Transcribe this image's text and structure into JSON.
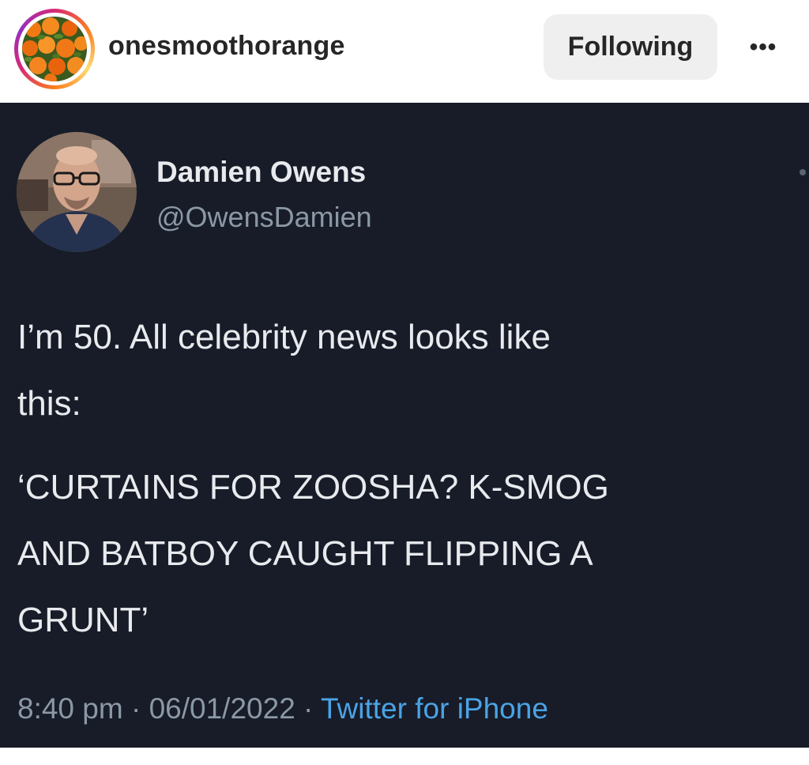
{
  "instagram": {
    "username": "onesmoothorange",
    "follow_label": "Following",
    "more_label": "•••"
  },
  "tweet": {
    "display_name": "Damien Owens",
    "handle": "@OwensDamien",
    "body_lines": [
      "I’m 50. All celebrity news looks like",
      "this:",
      "‘CURTAINS FOR ZOOSHA? K-SMOG",
      "AND BATBOY CAUGHT FLIPPING A",
      "GRUNT’"
    ],
    "time": "8:40 pm",
    "separator": " · ",
    "date": "06/01/2022",
    "source": "Twitter for iPhone"
  },
  "colors": {
    "tweet_bg": "#171c28",
    "link_blue": "#4ba3e6",
    "muted": "#8b98a5"
  }
}
